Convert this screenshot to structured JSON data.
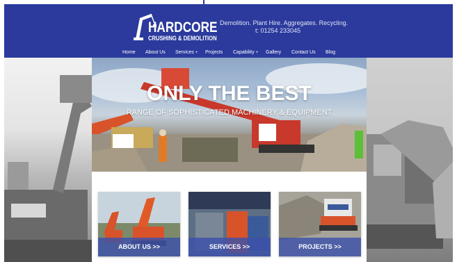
{
  "header": {
    "logo": {
      "title": "HARDCORE",
      "subtitle": "CRUSHING & DEMOLITION"
    },
    "tagline": "Demolition. Plant Hire. Aggregates. Recycling.",
    "phone": "t: 01254 233045"
  },
  "nav": {
    "items": [
      {
        "label": "Home"
      },
      {
        "label": "About Us"
      },
      {
        "label": "Services",
        "has_dropdown": true
      },
      {
        "label": "Projects"
      },
      {
        "label": "Capability",
        "has_dropdown": true
      },
      {
        "label": "Gallery"
      },
      {
        "label": "Contact Us"
      },
      {
        "label": "Blog"
      }
    ],
    "dropdown_caret": "+"
  },
  "hero": {
    "title": "ONLY THE BEST",
    "subtitle": "RANGE OF SOPHISTICATED MACHINERY & EQUIPMENT"
  },
  "cards": [
    {
      "label": "ABOUT US  >>"
    },
    {
      "label": "SERVICES  >>"
    },
    {
      "label": "PROJECTS  >>"
    }
  ],
  "colors": {
    "header_bg": "#2b3a9c",
    "card_label_bg": "#3c50aa",
    "machine_orange": "#d8532a",
    "machine_red": "#c8392b"
  }
}
